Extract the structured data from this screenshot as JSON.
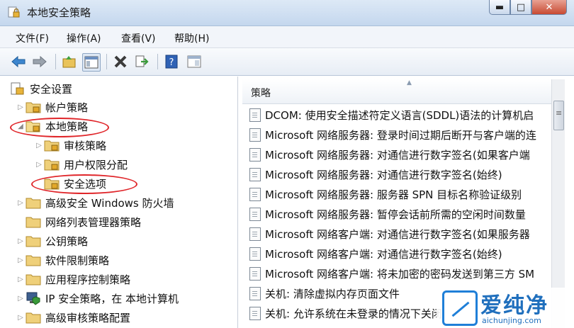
{
  "window": {
    "title": "本地安全策略",
    "min": "▬",
    "max": "□",
    "close": "✕"
  },
  "menu": [
    "文件(F)",
    "操作(A)",
    "查看(V)",
    "帮助(H)"
  ],
  "toolbar": [
    "back-arrow-icon",
    "forward-arrow-icon",
    "up-folder-icon",
    "show-hide-tree-icon",
    "delete-icon",
    "export-list-icon",
    "help-icon",
    "properties-icon"
  ],
  "tree": {
    "root": "安全设置",
    "items": [
      {
        "label": "帐户策略"
      },
      {
        "label": "本地策略"
      },
      {
        "label": "审核策略"
      },
      {
        "label": "用户权限分配"
      },
      {
        "label": "安全选项"
      },
      {
        "label": "高级安全 Windows 防火墙"
      },
      {
        "label": "网络列表管理器策略"
      },
      {
        "label": "公钥策略"
      },
      {
        "label": "软件限制策略"
      },
      {
        "label": "应用程序控制策略"
      },
      {
        "label": "IP 安全策略，在 本地计算机"
      },
      {
        "label": "高级审核策略配置"
      }
    ]
  },
  "list": {
    "header": "策略",
    "rows": [
      "DCOM: 使用安全描述符定义语言(SDDL)语法的计算机启",
      "Microsoft 网络服务器: 登录时间过期后断开与客户端的连",
      "Microsoft 网络服务器: 对通信进行数字签名(如果客户端",
      "Microsoft 网络服务器: 对通信进行数字签名(始终)",
      "Microsoft 网络服务器: 服务器 SPN 目标名称验证级别",
      "Microsoft 网络服务器: 暂停会话前所需的空闲时间数量",
      "Microsoft 网络客户端: 对通信进行数字签名(如果服务器",
      "Microsoft 网络客户端: 对通信进行数字签名(始终)",
      "Microsoft 网络客户端: 将未加密的密码发送到第三方 SM",
      "关机: 清除虚拟内存页面文件",
      "关机: 允许系统在未登录的情况下关闭"
    ]
  },
  "watermark": {
    "brand": "爱纯净",
    "url": "aichunjing.com"
  },
  "colors": {
    "highlight": "#e0262a",
    "watermark": "#1f6fbd"
  }
}
